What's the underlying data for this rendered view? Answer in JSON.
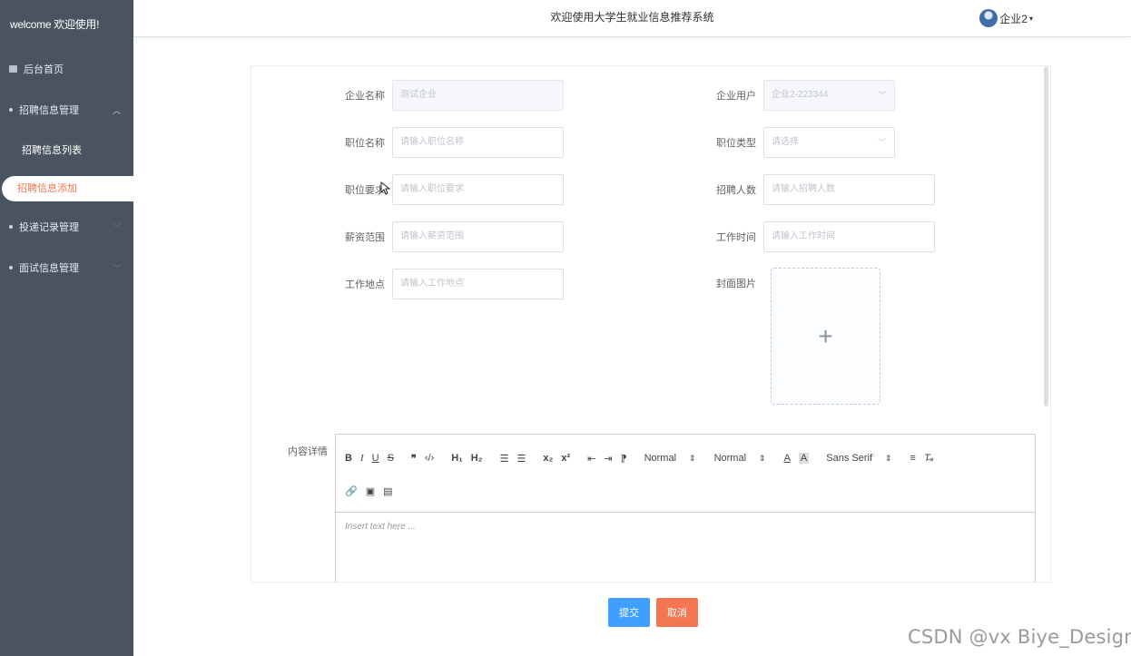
{
  "sidebar": {
    "welcome": "welcome 欢迎使用!",
    "home": "后台首页",
    "recruit_group": "招聘信息管理",
    "recruit_list": "招聘信息列表",
    "recruit_add": "招聘信息添加",
    "delivery_group": "投递记录管理",
    "interview_group": "面试信息管理"
  },
  "header": {
    "title": "欢迎使用大学生就业信息推荐系统",
    "user": "企业2"
  },
  "form": {
    "company_name": {
      "label": "企业名称",
      "value": "测试企业"
    },
    "company_user": {
      "label": "企业用户",
      "value": "企业2-223344"
    },
    "job_name": {
      "label": "职位名称",
      "placeholder": "请输入职位名称"
    },
    "job_type": {
      "label": "职位类型",
      "placeholder": "请选择"
    },
    "job_req": {
      "label": "职位要求",
      "placeholder": "请输入职位要求"
    },
    "headcount": {
      "label": "招聘人数",
      "placeholder": "请输入招聘人数"
    },
    "salary": {
      "label": "薪资范围",
      "placeholder": "请输入薪资范围"
    },
    "work_time": {
      "label": "工作时间",
      "placeholder": "请输入工作时间"
    },
    "location": {
      "label": "工作地点",
      "placeholder": "请输入工作地点"
    },
    "cover": {
      "label": "封面图片",
      "plus": "+"
    },
    "content": {
      "label": "内容详情"
    }
  },
  "editor": {
    "bold": "B",
    "italic": "I",
    "underline": "U",
    "strike": "S",
    "quote": "❞",
    "code": "‹/›",
    "h1": "H₁",
    "h2": "H₂",
    "ol": "☰",
    "ul": "☰",
    "sub": "x₂",
    "sup": "x²",
    "outdent": "⇤",
    "indent": "⇥",
    "rtl": "⁋",
    "size_picker": "Normal",
    "header_picker": "Normal",
    "color": "A",
    "background": "A",
    "font_picker": "Sans Serif",
    "align": "≡",
    "clean": "T̶ₓ",
    "link": "🔗",
    "image": "▣",
    "video": "▤",
    "placeholder": "Insert text here ..."
  },
  "buttons": {
    "submit": "提交",
    "cancel": "取消"
  },
  "watermark": "CSDN @vx Biye_Design"
}
